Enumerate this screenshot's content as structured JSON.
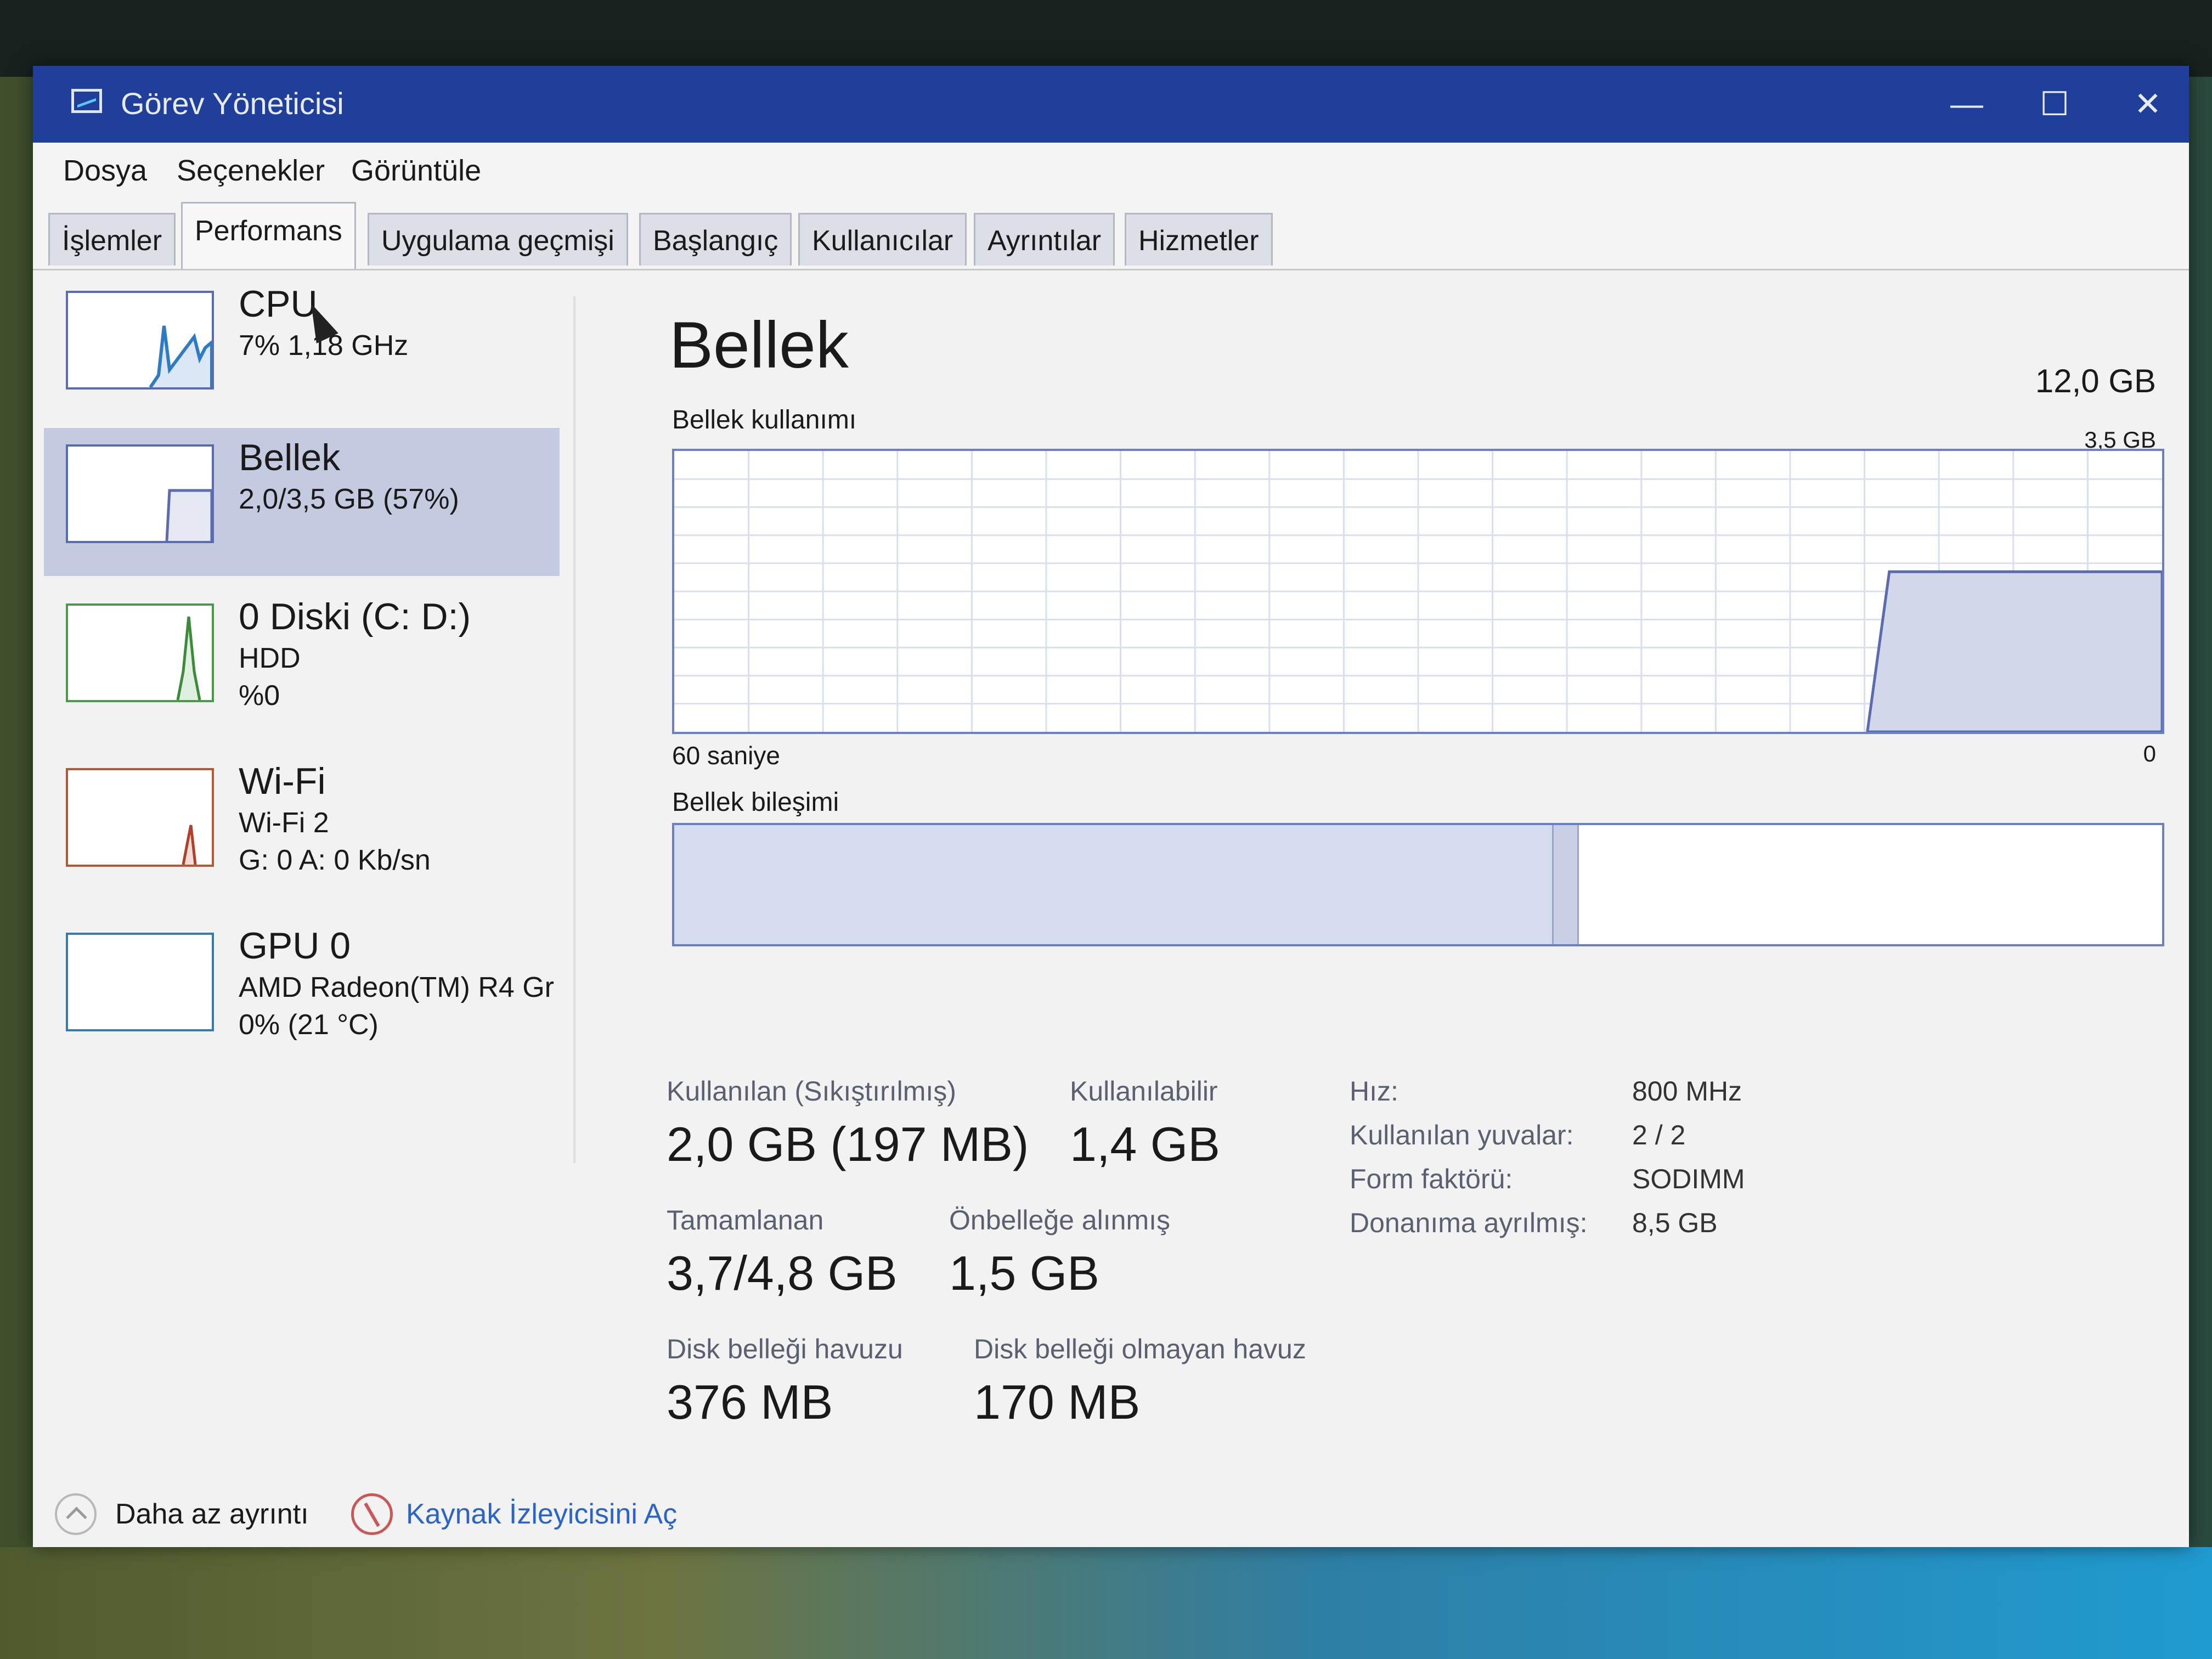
{
  "window": {
    "title": "Görev Yöneticisi"
  },
  "window_controls": {
    "minimize": "—",
    "maximize": "☐",
    "close": "✕"
  },
  "menu": [
    "Dosya",
    "Seçenekler",
    "Görüntüle"
  ],
  "tabs": [
    {
      "label": "İşlemler",
      "active": false
    },
    {
      "label": "Performans",
      "active": true
    },
    {
      "label": "Uygulama geçmişi",
      "active": false
    },
    {
      "label": "Başlangıç",
      "active": false
    },
    {
      "label": "Kullanıcılar",
      "active": false
    },
    {
      "label": "Ayrıntılar",
      "active": false
    },
    {
      "label": "Hizmetler",
      "active": false
    }
  ],
  "sidebar": {
    "items": [
      {
        "title": "CPU",
        "line1": "7% 1,18 GHz",
        "line2": ""
      },
      {
        "title": "Bellek",
        "line1": "2,0/3,5 GB (57%)",
        "line2": ""
      },
      {
        "title": "0 Diski (C: D:)",
        "line1": "HDD",
        "line2": "%0"
      },
      {
        "title": "Wi-Fi",
        "line1": "Wi-Fi 2",
        "line2": "G: 0 A: 0 Kb/sn"
      },
      {
        "title": "GPU 0",
        "line1": "AMD Radeon(TM) R4 Gr",
        "line2": "0% (21 °C)"
      }
    ]
  },
  "main": {
    "title": "Bellek",
    "capacity": "12,0 GB",
    "usage_label": "Bellek kullanımı",
    "usage_max": "3,5 GB",
    "time_left": "60 saniye",
    "time_right": "0",
    "composition_label": "Bellek bileşimi",
    "usage_history": [
      0,
      0,
      0,
      0,
      0,
      0,
      0,
      0,
      0,
      0,
      0,
      0,
      0,
      0,
      0,
      0,
      0,
      0,
      0,
      0,
      0,
      0,
      0,
      0,
      0,
      0,
      0,
      0,
      0,
      0,
      0,
      0,
      0,
      0,
      0,
      0,
      0,
      0,
      0,
      0,
      0,
      0,
      0,
      0,
      0,
      0,
      0,
      0,
      0,
      0.57,
      0.57,
      0.57,
      0.57,
      0.57,
      0.57,
      0.57,
      0.57,
      0.57,
      0.57,
      0.57,
      0.57
    ],
    "composition": {
      "in_use_fraction": 0.59,
      "modified_fraction": 0.016
    },
    "stats": [
      {
        "label": "Kullanılan (Sıkıştırılmış)",
        "value": "2,0 GB (197 MB)"
      },
      {
        "label": "Kullanılabilir",
        "value": "1,4 GB"
      },
      {
        "label": "Tamamlanan",
        "value": "3,7/4,8 GB"
      },
      {
        "label": "Önbelleğe alınmış",
        "value": "1,5 GB"
      },
      {
        "label": "Disk belleği havuzu",
        "value": "376 MB"
      },
      {
        "label": "Disk belleği olmayan havuz",
        "value": "170 MB"
      }
    ],
    "properties": [
      {
        "label": "Hız:",
        "value": "800 MHz"
      },
      {
        "label": "Kullanılan yuvalar:",
        "value": "2 / 2"
      },
      {
        "label": "Form faktörü:",
        "value": "SODIMM"
      },
      {
        "label": "Donanıma ayrılmış:",
        "value": "8,5 GB"
      }
    ]
  },
  "footer": {
    "fewer_details": "Daha az ayrıntı",
    "open_resource_monitor": "Kaynak İzleyicisini Aç"
  },
  "colors": {
    "titlebar": "#1f3f9a",
    "graph_border": "#6c7fc4",
    "selected": "#c4cbe0",
    "link": "#2a64c8"
  }
}
